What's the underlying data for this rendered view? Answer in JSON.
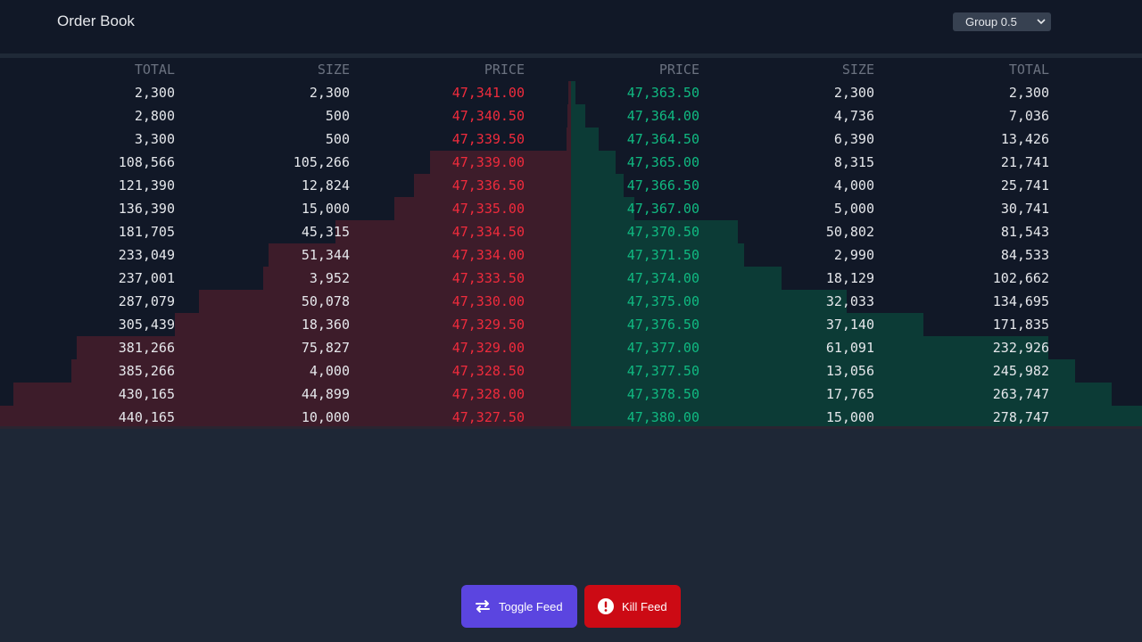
{
  "header": {
    "title": "Order Book",
    "group_select": "Group 0.5"
  },
  "colors": {
    "bid_price": "#ef2b3c",
    "ask_price": "#10b981",
    "bid_depth": "#3d1c2a",
    "ask_depth": "#0c3b36",
    "toggle_button": "#5b45e0",
    "kill_button": "#cc0a14"
  },
  "bids": {
    "columns": [
      "TOTAL",
      "SIZE",
      "PRICE"
    ],
    "rows": [
      {
        "total": "2,300",
        "size": "2,300",
        "price": "47,341.00"
      },
      {
        "total": "2,800",
        "size": "500",
        "price": "47,340.50"
      },
      {
        "total": "3,300",
        "size": "500",
        "price": "47,339.50"
      },
      {
        "total": "108,566",
        "size": "105,266",
        "price": "47,339.00"
      },
      {
        "total": "121,390",
        "size": "12,824",
        "price": "47,336.50"
      },
      {
        "total": "136,390",
        "size": "15,000",
        "price": "47,335.00"
      },
      {
        "total": "181,705",
        "size": "45,315",
        "price": "47,334.50"
      },
      {
        "total": "233,049",
        "size": "51,344",
        "price": "47,334.00"
      },
      {
        "total": "237,001",
        "size": "3,952",
        "price": "47,333.50"
      },
      {
        "total": "287,079",
        "size": "50,078",
        "price": "47,330.00"
      },
      {
        "total": "305,439",
        "size": "18,360",
        "price": "47,329.50"
      },
      {
        "total": "381,266",
        "size": "75,827",
        "price": "47,329.00"
      },
      {
        "total": "385,266",
        "size": "4,000",
        "price": "47,328.50"
      },
      {
        "total": "430,165",
        "size": "44,899",
        "price": "47,328.00"
      },
      {
        "total": "440,165",
        "size": "10,000",
        "price": "47,327.50"
      }
    ]
  },
  "asks": {
    "columns": [
      "PRICE",
      "SIZE",
      "TOTAL"
    ],
    "rows": [
      {
        "price": "47,363.50",
        "size": "2,300",
        "total": "2,300"
      },
      {
        "price": "47,364.00",
        "size": "4,736",
        "total": "7,036"
      },
      {
        "price": "47,364.50",
        "size": "6,390",
        "total": "13,426"
      },
      {
        "price": "47,365.00",
        "size": "8,315",
        "total": "21,741"
      },
      {
        "price": "47,366.50",
        "size": "4,000",
        "total": "25,741"
      },
      {
        "price": "47,367.00",
        "size": "5,000",
        "total": "30,741"
      },
      {
        "price": "47,370.50",
        "size": "50,802",
        "total": "81,543"
      },
      {
        "price": "47,371.50",
        "size": "2,990",
        "total": "84,533"
      },
      {
        "price": "47,374.00",
        "size": "18,129",
        "total": "102,662"
      },
      {
        "price": "47,375.00",
        "size": "32,033",
        "total": "134,695"
      },
      {
        "price": "47,376.50",
        "size": "37,140",
        "total": "171,835"
      },
      {
        "price": "47,377.00",
        "size": "61,091",
        "total": "232,926"
      },
      {
        "price": "47,377.50",
        "size": "13,056",
        "total": "245,982"
      },
      {
        "price": "47,378.50",
        "size": "17,765",
        "total": "263,747"
      },
      {
        "price": "47,380.00",
        "size": "15,000",
        "total": "278,747"
      }
    ]
  },
  "buttons": {
    "toggle_label": "Toggle Feed",
    "kill_label": "Kill Feed",
    "toggle_icon": "swap-arrows-icon",
    "kill_icon": "alert-circle-icon"
  }
}
